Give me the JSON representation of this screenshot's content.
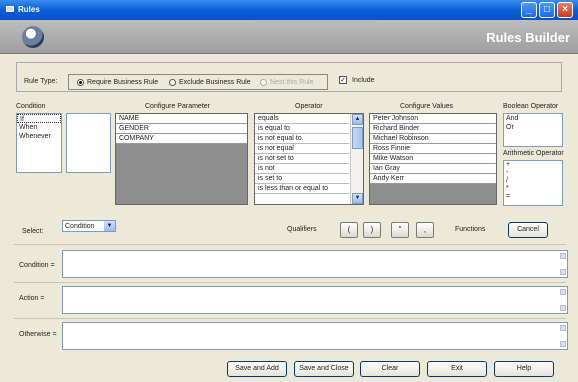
{
  "window": {
    "title": "Rules"
  },
  "header": {
    "title": "Rules Builder"
  },
  "rule_type": {
    "label": "Rule Type:",
    "options": [
      {
        "label": "Require Business Rule",
        "selected": true,
        "enabled": true
      },
      {
        "label": "Exclude Business Rule",
        "selected": false,
        "enabled": true
      },
      {
        "label": "Nest this Rule",
        "selected": false,
        "enabled": false
      }
    ],
    "include_label": "Include",
    "include_checked": true
  },
  "columns": {
    "condition": "Condition",
    "configure_parameter": "Configure Parameter",
    "operator": "Operator",
    "configure_values": "Configure Values",
    "boolean_operator": "Boolean Operator",
    "arithmetic_operator": "Arithmetic Operator"
  },
  "condition_items": [
    "If",
    "When",
    "Whenever"
  ],
  "parameter_items": [
    "NAME",
    "GENDER",
    "COMPANY"
  ],
  "operator_items": [
    "equals",
    "is equal to",
    "is not equal to.",
    "is not equal",
    "is not set to",
    "is not",
    "is set to",
    "is less than or equal to"
  ],
  "value_items": [
    "Peter Johnson",
    "Richard Binder",
    "Michael Robinson",
    "Ross Finnie",
    "Mike Watson",
    "Ian Gray",
    "Andy Kerr"
  ],
  "boolean_items": [
    "And",
    "Or"
  ],
  "arithmetic_items": [
    "+",
    "-",
    "/",
    "*",
    "="
  ],
  "select": {
    "label": "Select:",
    "value": "Condition"
  },
  "qualifiers": {
    "label": "Qualifiers",
    "buttons": [
      "(",
      ")",
      "\"",
      ","
    ]
  },
  "functions": {
    "label": "Functions",
    "button": "Cancel"
  },
  "fields": {
    "condition_label": "Condition =",
    "action_label": "Action =",
    "otherwise_label": "Otherwise ="
  },
  "footer": {
    "save_add": "Save and Add",
    "save_close": "Save and Close",
    "clear": "Clear",
    "exit": "Exit",
    "help": "Help"
  },
  "colors": {
    "title_bar": "#0a5fd8",
    "header": "#a8a8a8",
    "window_bg": "#ece9d8"
  }
}
